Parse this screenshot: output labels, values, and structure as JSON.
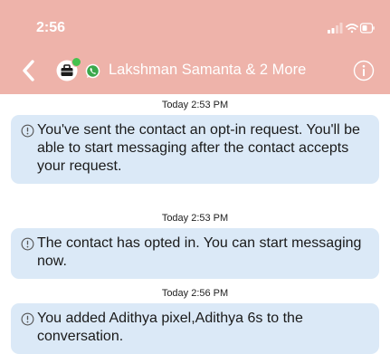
{
  "status_bar": {
    "time": "2:56"
  },
  "header": {
    "title": "Lakshman Samanta & 2 More"
  },
  "messages": [
    {
      "timestamp": "Today 2:53 PM",
      "text": "You've sent the contact an opt-in request. You'll be able to start messaging after the contact accepts your request."
    },
    {
      "timestamp": "Today 2:53 PM",
      "text": "The contact has opted in. You can start messaging now."
    },
    {
      "timestamp": "Today 2:56 PM",
      "text": "You added Adithya pixel,Adithya 6s to the conversation."
    }
  ],
  "colors": {
    "header_bg": "#eeb3aa",
    "bubble_bg": "#dbe9f7",
    "presence_dot": "#44c24e"
  },
  "icons": [
    "chevron-left-icon",
    "briefcase-avatar-icon",
    "whatsapp-icon",
    "info-icon",
    "signal-icon",
    "wifi-icon",
    "battery-icon",
    "info-circle-icon"
  ]
}
